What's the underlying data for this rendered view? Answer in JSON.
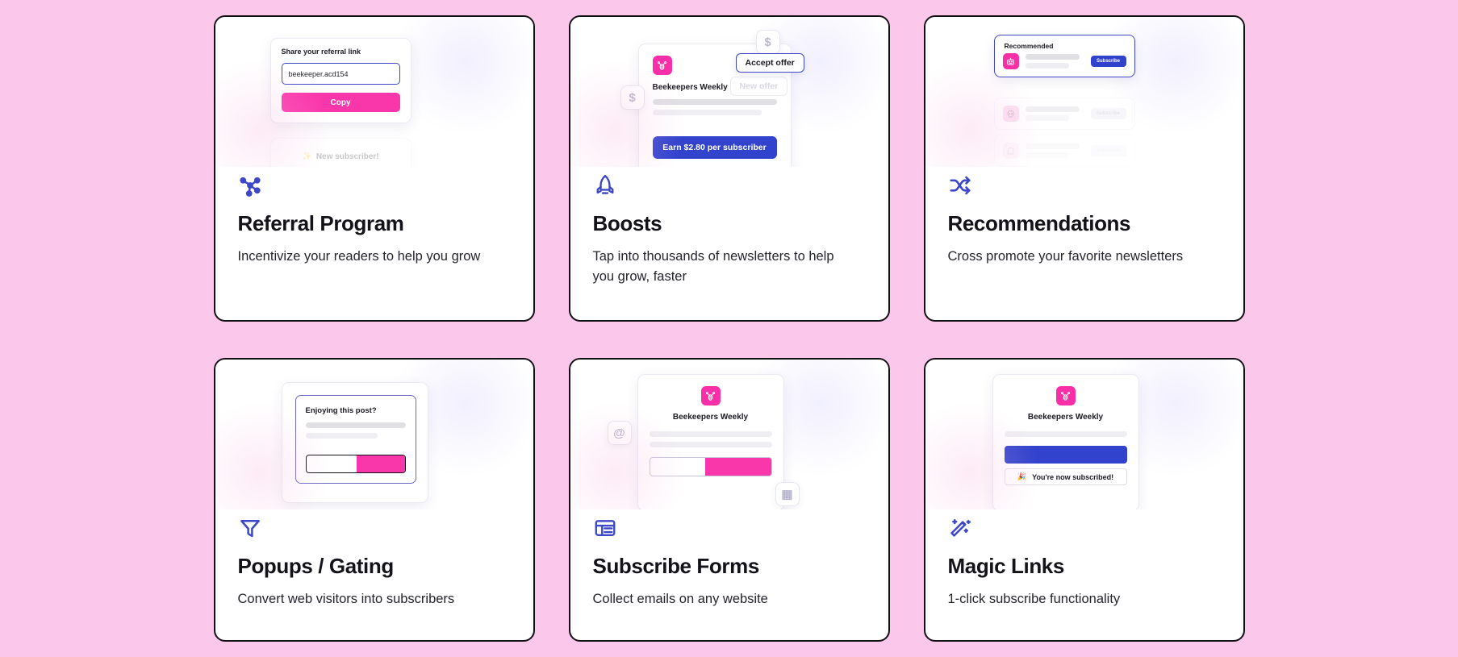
{
  "theme": {
    "background": "#fbc7ea",
    "card_background": "#ffffff",
    "card_border": "#111013",
    "accent_pink": "#fa36ab",
    "accent_blue": "#3142cd",
    "icon_blue": "#3d47c8"
  },
  "cards": [
    {
      "id": "referral-program",
      "icon": "share-network-icon",
      "title": "Referral Program",
      "description": "Incentivize your readers to help you grow",
      "illustration": {
        "label": "Share your referral link",
        "input_value": "beekeeper.acd154",
        "button_label": "Copy",
        "ghost_toast": "New subscriber!"
      }
    },
    {
      "id": "boosts",
      "icon": "rocket-icon",
      "title": "Boosts",
      "description": "Tap into thousands of newsletters to help you grow, faster",
      "illustration": {
        "publication": "Beekeepers Weekly",
        "primary_button": "Earn $2.80 per subscriber",
        "accept_button": "Accept offer",
        "new_offer_button": "New offer",
        "badge_1": "$",
        "badge_2": "$"
      }
    },
    {
      "id": "recommendations",
      "icon": "shuffle-icon",
      "title": "Recommendations",
      "description": "Cross promote your favorite newsletters",
      "illustration": {
        "section_label": "Recommended",
        "rows": [
          {
            "avatar": "robot-emoji",
            "button": "Subscribe"
          },
          {
            "avatar": "alien-emoji",
            "button": "Subscribe"
          },
          {
            "avatar": "ghost-emoji",
            "button": "Subscribe"
          }
        ]
      }
    },
    {
      "id": "popups-gating",
      "icon": "funnel-icon",
      "title": "Popups / Gating",
      "description": "Convert web visitors into subscribers",
      "illustration": {
        "headline": "Enjoying this post?",
        "input_placeholder": "",
        "submit_button": ""
      }
    },
    {
      "id": "subscribe-forms",
      "icon": "form-list-icon",
      "title": "Subscribe Forms",
      "description": "Collect emails on any website",
      "illustration": {
        "publication": "Beekeepers Weekly",
        "at_badge": "@",
        "grid_badge": "▦"
      }
    },
    {
      "id": "magic-links",
      "icon": "magic-wand-icon",
      "title": "Magic Links",
      "description": "1-click subscribe functionality",
      "illustration": {
        "publication": "Beekeepers Weekly",
        "toast": "You're now subscribed!",
        "toast_emoji": "party-popper-emoji"
      }
    }
  ]
}
